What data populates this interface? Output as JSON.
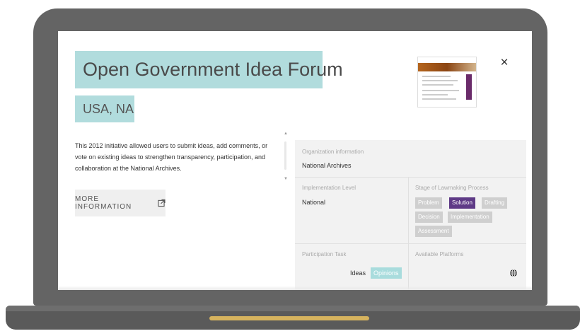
{
  "page": {
    "title": "Open Government Idea Forum",
    "subtitle": "USA, NA",
    "description": "This 2012 initiative allowed users to submit ideas, add comments, or vote on existing ideas to strengthen transparency, participation, and collaboration at the National Archives.",
    "more_info_label": "MORE INFORMATION",
    "close_label": "×"
  },
  "info": {
    "org_label": "Organization information",
    "org_value": "National Archives",
    "impl_label": "Implementation Level",
    "impl_value": "National",
    "stage_label": "Stage of Lawmaking Process",
    "stages": [
      "Problem",
      "Solution",
      "Drafting",
      "Decision",
      "Implementation",
      "Assessment"
    ],
    "active_stage": "Solution",
    "task_label": "Participation Task",
    "tasks": [
      "Ideas",
      "Opinions"
    ],
    "platforms_label": "Available Platforms"
  },
  "colors": {
    "highlight": "#b1dcdd",
    "active_tag": "#5e3a86",
    "inactive_tag": "#cfcfcf",
    "laptop_body": "#646464",
    "hinge_accent": "#d6b35e"
  },
  "icons": {
    "external": "external-link-icon",
    "close": "close-icon",
    "globe": "globe-icon"
  }
}
